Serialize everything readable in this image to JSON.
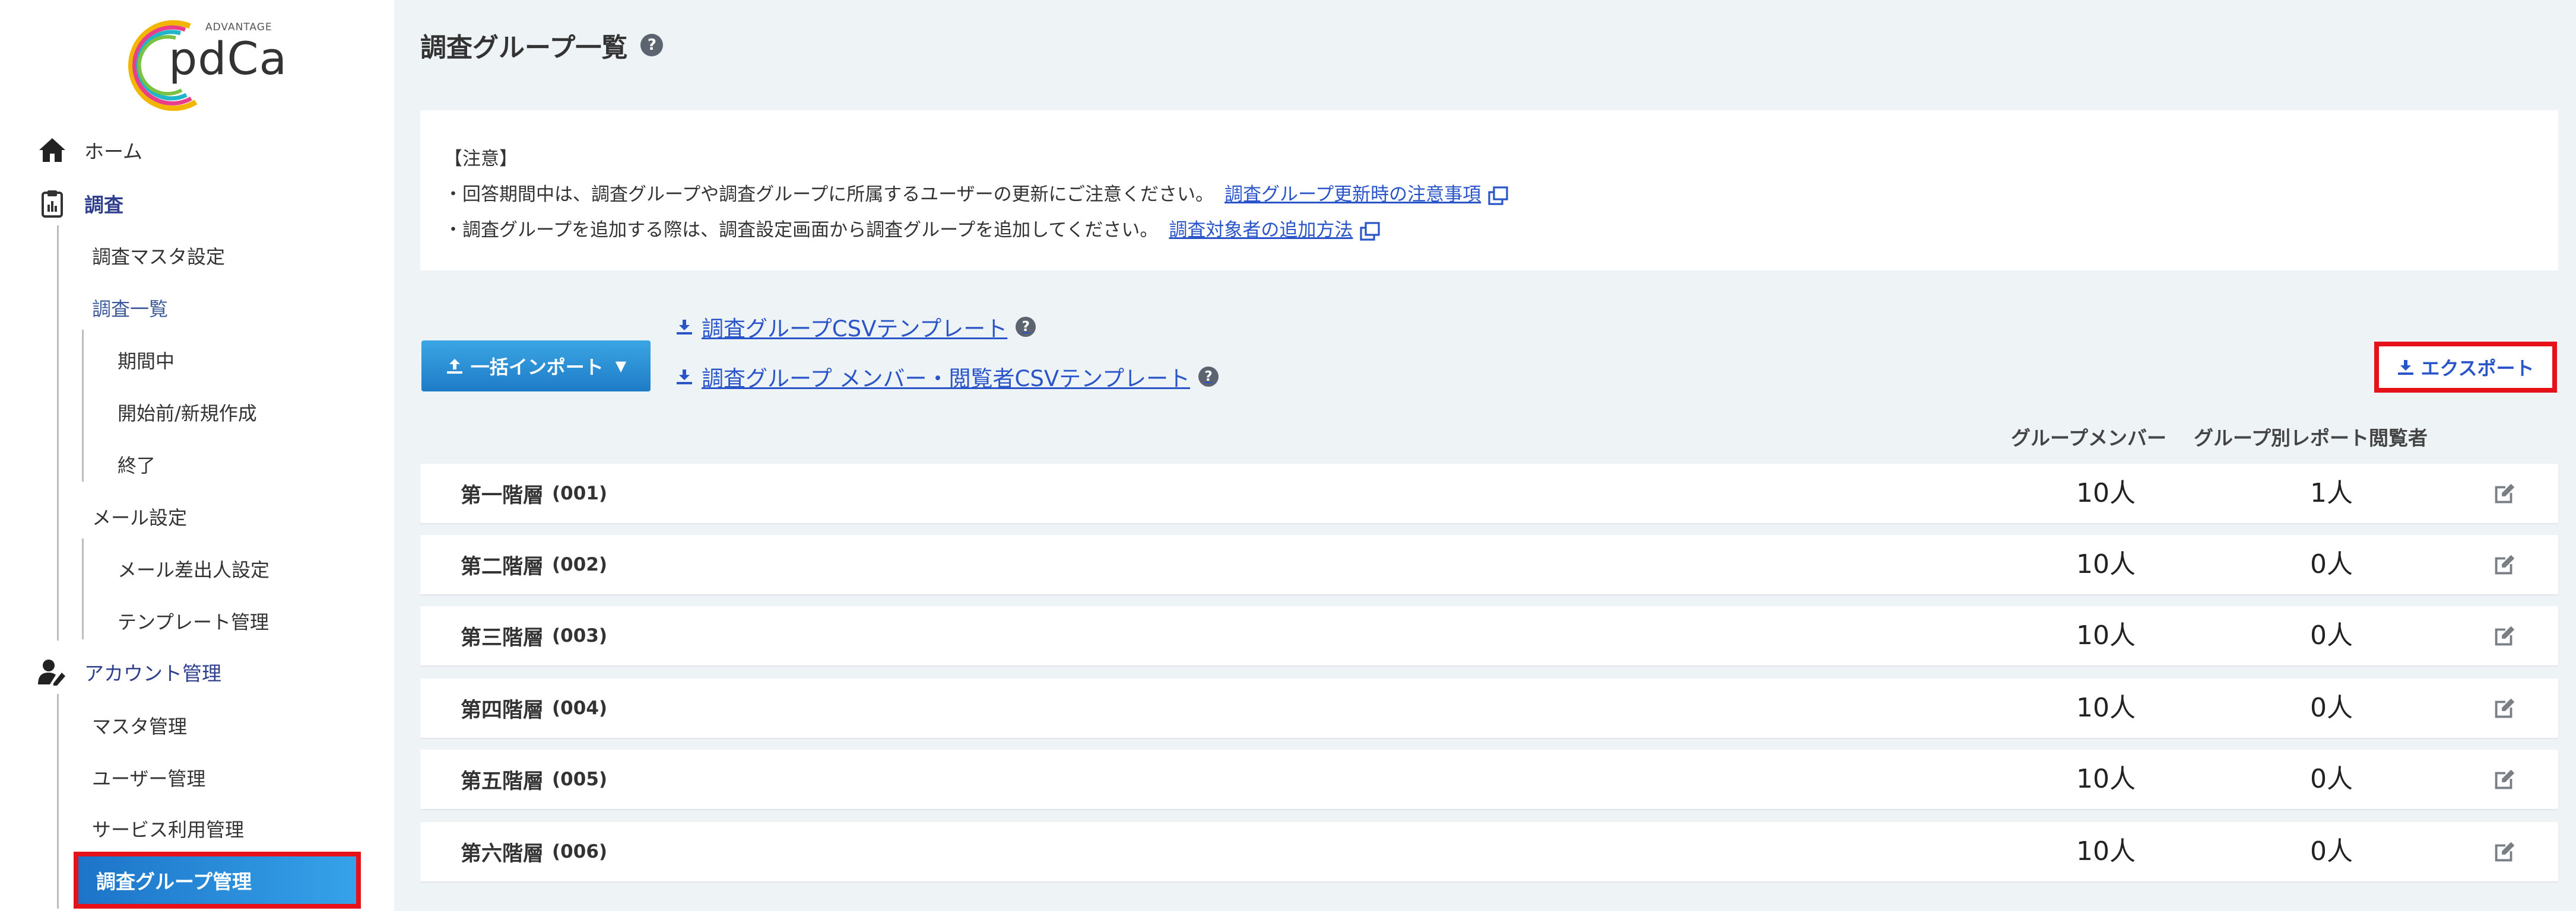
{
  "logo": {
    "small": "ADVANTAGE",
    "main": "pdCa"
  },
  "sidebar": {
    "home": "ホーム",
    "survey": "調査",
    "survey_master": "調査マスタ設定",
    "survey_list": "調査一覧",
    "in_period": "期間中",
    "before_start": "開始前/新規作成",
    "ended": "終了",
    "mail_settings": "メール設定",
    "mail_sender": "メール差出人設定",
    "template_mgmt": "テンプレート管理",
    "account_mgmt": "アカウント管理",
    "master_mgmt": "マスタ管理",
    "user_mgmt": "ユーザー管理",
    "service_mgmt": "サービス利用管理",
    "group_mgmt": "調査グループ管理"
  },
  "page": {
    "title": "調査グループ一覧",
    "help": "?"
  },
  "notice": {
    "heading": "【注意】",
    "line1": "・回答期間中は、調査グループや調査グループに所属するユーザーの更新にご注意ください。",
    "link1": "調査グループ更新時の注意事項",
    "line2": "・調査グループを追加する際は、調査設定画面から調査グループを追加してください。",
    "link2": "調査対象者の追加方法"
  },
  "toolbar": {
    "import_label": "一括インポート",
    "csv_template": "調査グループCSVテンプレート",
    "member_csv_template": "調査グループ メンバー・閲覧者CSVテンプレート",
    "export_label": "エクスポート"
  },
  "table": {
    "col_members": "グループメンバー",
    "col_viewers": "グループ別レポート閲覧者",
    "rows": [
      {
        "name": "第一階層",
        "code": "(001)",
        "members": "10人",
        "viewers": "1人"
      },
      {
        "name": "第二階層",
        "code": "(002)",
        "members": "10人",
        "viewers": "0人"
      },
      {
        "name": "第三階層",
        "code": "(003)",
        "members": "10人",
        "viewers": "0人"
      },
      {
        "name": "第四階層",
        "code": "(004)",
        "members": "10人",
        "viewers": "0人"
      },
      {
        "name": "第五階層",
        "code": "(005)",
        "members": "10人",
        "viewers": "0人"
      },
      {
        "name": "第六階層",
        "code": "(006)",
        "members": "10人",
        "viewers": "0人"
      }
    ]
  },
  "colors": {
    "accent_blue": "#1f7bc6",
    "link_blue": "#2a55c8",
    "highlight_red": "#e5121a",
    "background": "#eef3f6"
  }
}
